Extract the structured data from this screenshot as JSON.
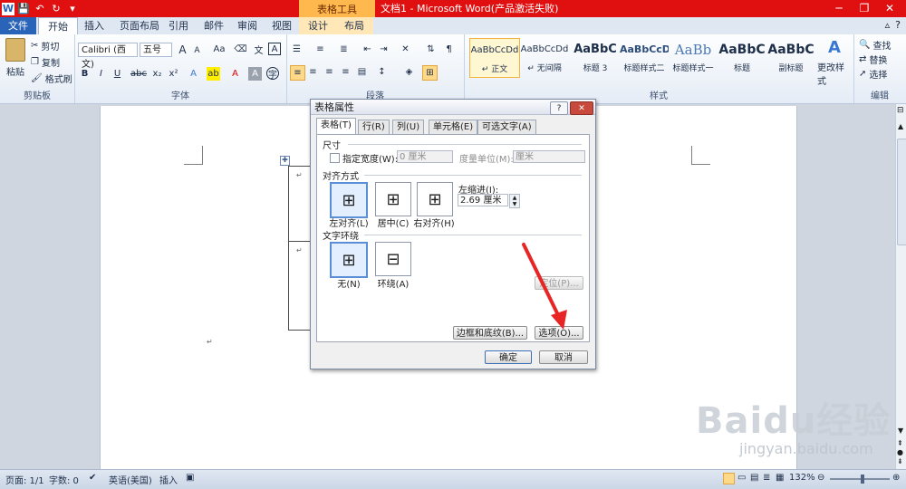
{
  "window": {
    "table_tools_label": "表格工具",
    "doc_title": "文档1 - Microsoft Word(产品激活失败)",
    "minimize": "─",
    "restore": "❐",
    "close": "✕"
  },
  "tabs": [
    {
      "label": "文件"
    },
    {
      "label": "开始"
    },
    {
      "label": "插入"
    },
    {
      "label": "页面布局"
    },
    {
      "label": "引用"
    },
    {
      "label": "邮件"
    },
    {
      "label": "审阅"
    },
    {
      "label": "视图"
    },
    {
      "label": "设计"
    },
    {
      "label": "布局"
    }
  ],
  "ribbon": {
    "clipboard": {
      "paste": "粘贴",
      "cut": "剪切",
      "copy": "复制",
      "format_painter": "格式刷",
      "group": "剪贴板"
    },
    "font": {
      "font_name": "Calibri (西文)",
      "font_size": "五号",
      "group": "字体",
      "bold": "B",
      "italic": "I",
      "underline": "U",
      "strike": "abc",
      "sub": "x₂",
      "sup": "x²",
      "grow": "A",
      "shrink": "A",
      "case": "Aa"
    },
    "paragraph": {
      "group": "段落"
    },
    "styles": {
      "group": "样式",
      "items": [
        {
          "preview": "AaBbCcDd",
          "name": "↵ 正文"
        },
        {
          "preview": "AaBbCcDd",
          "name": "↵ 无间隔"
        },
        {
          "preview": "AaBbC",
          "name": "标题 3"
        },
        {
          "preview": "AaBbCcD",
          "name": "标题样式二"
        },
        {
          "preview": "AaBb",
          "name": "标题样式一"
        },
        {
          "preview": "AaBbC",
          "name": "标题"
        },
        {
          "preview": "AaBbC",
          "name": "副标题"
        }
      ],
      "change_styles": "更改样式"
    },
    "editing": {
      "find": "查找",
      "replace": "替换",
      "select": "选择",
      "group": "编辑"
    }
  },
  "document": {
    "return_mark": "↵"
  },
  "dialog": {
    "title": "表格属性",
    "help": "?",
    "close": "✕",
    "tabs": [
      {
        "label": "表格(T)"
      },
      {
        "label": "行(R)"
      },
      {
        "label": "列(U)"
      },
      {
        "label": "单元格(E)"
      },
      {
        "label": "可选文字(A)"
      }
    ],
    "size_section": "尺寸",
    "preferred_width_label": "指定宽度(W):",
    "preferred_width_value": "0 厘米",
    "measure_label": "度量单位(M):",
    "measure_value": "厘米",
    "alignment_section": "对齐方式",
    "align_left": "左对齐(L)",
    "align_center": "居中(C)",
    "align_right": "右对齐(H)",
    "indent_label": "左缩进(I):",
    "indent_value": "2.69 厘米",
    "wrap_section": "文字环绕",
    "wrap_none": "无(N)",
    "wrap_around": "环绕(A)",
    "positioning": "定位(P)...",
    "borders_button": "边框和底纹(B)...",
    "options_button": "选项(O)...",
    "ok": "确定",
    "cancel": "取消"
  },
  "statusbar": {
    "page": "页面: 1/1",
    "words": "字数: 0",
    "language": "英语(美国)",
    "mode": "插入",
    "zoom": "132%"
  },
  "watermark": {
    "brand": "Baidu经验",
    "url": "jingyan.baidu.com"
  },
  "colors": {
    "title_red": "#e01010",
    "file_blue": "#2a64b8",
    "accent_orange": "#ffb84d"
  }
}
